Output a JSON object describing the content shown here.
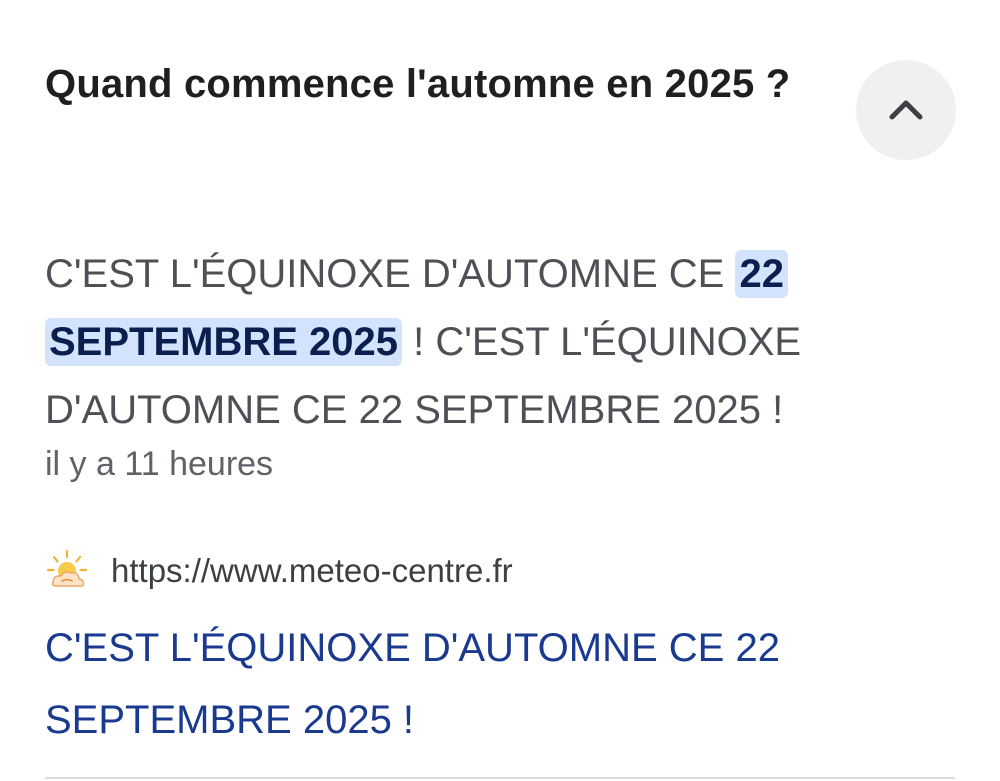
{
  "faq": {
    "question": "Quand commence l'automne en 2025 ?",
    "collapse_icon": "chevron-up-icon",
    "answer_highlight": "22 SEPTEMBRE 2025",
    "answer_prefix": "C'EST L'ÉQUINOXE D'AUTOMNE CE ",
    "answer_suffix": " ! C'EST L'ÉQUINOXE D'AUTOMNE CE 22 SEPTEMBRE 2025 !",
    "timestamp": "il y a 11 heures",
    "source": {
      "favicon": "sun-cloud-icon",
      "url": "https://www.meteo-centre.fr"
    },
    "result_title": "C'EST L'ÉQUINOXE D'AUTOMNE CE 22 SEPTEMBRE 2025 !"
  },
  "colors": {
    "highlight_bg": "#d3e3fd",
    "link": "#1a3a8f",
    "button_bg": "#f1eff0"
  }
}
